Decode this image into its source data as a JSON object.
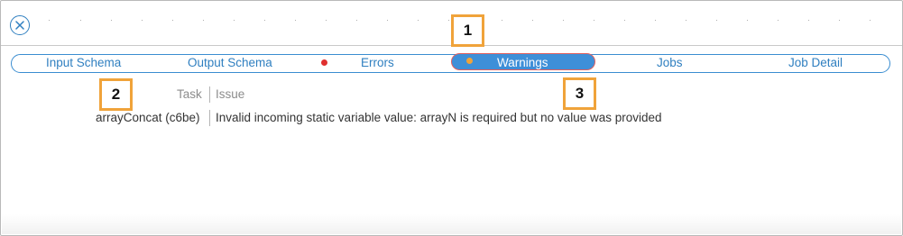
{
  "tabs": [
    {
      "label": "Input Schema"
    },
    {
      "label": "Output Schema"
    },
    {
      "label": "Errors",
      "status_color": "#e0302f"
    },
    {
      "label": "Warnings",
      "status_color": "#f0a33a",
      "active": true
    },
    {
      "label": "Jobs"
    },
    {
      "label": "Job Detail"
    }
  ],
  "callouts": [
    "1",
    "2",
    "3"
  ],
  "table": {
    "headers": [
      "Task",
      "Issue"
    ],
    "rows": [
      {
        "task": "arrayConcat (c6be)",
        "issue": "Invalid incoming static variable value: arrayN is required but no value was provided"
      }
    ]
  },
  "icons": {
    "close": "close-circle-icon"
  },
  "colors": {
    "accent": "#3e8fd8",
    "highlight": "#f0a33a",
    "error": "#e0302f"
  }
}
